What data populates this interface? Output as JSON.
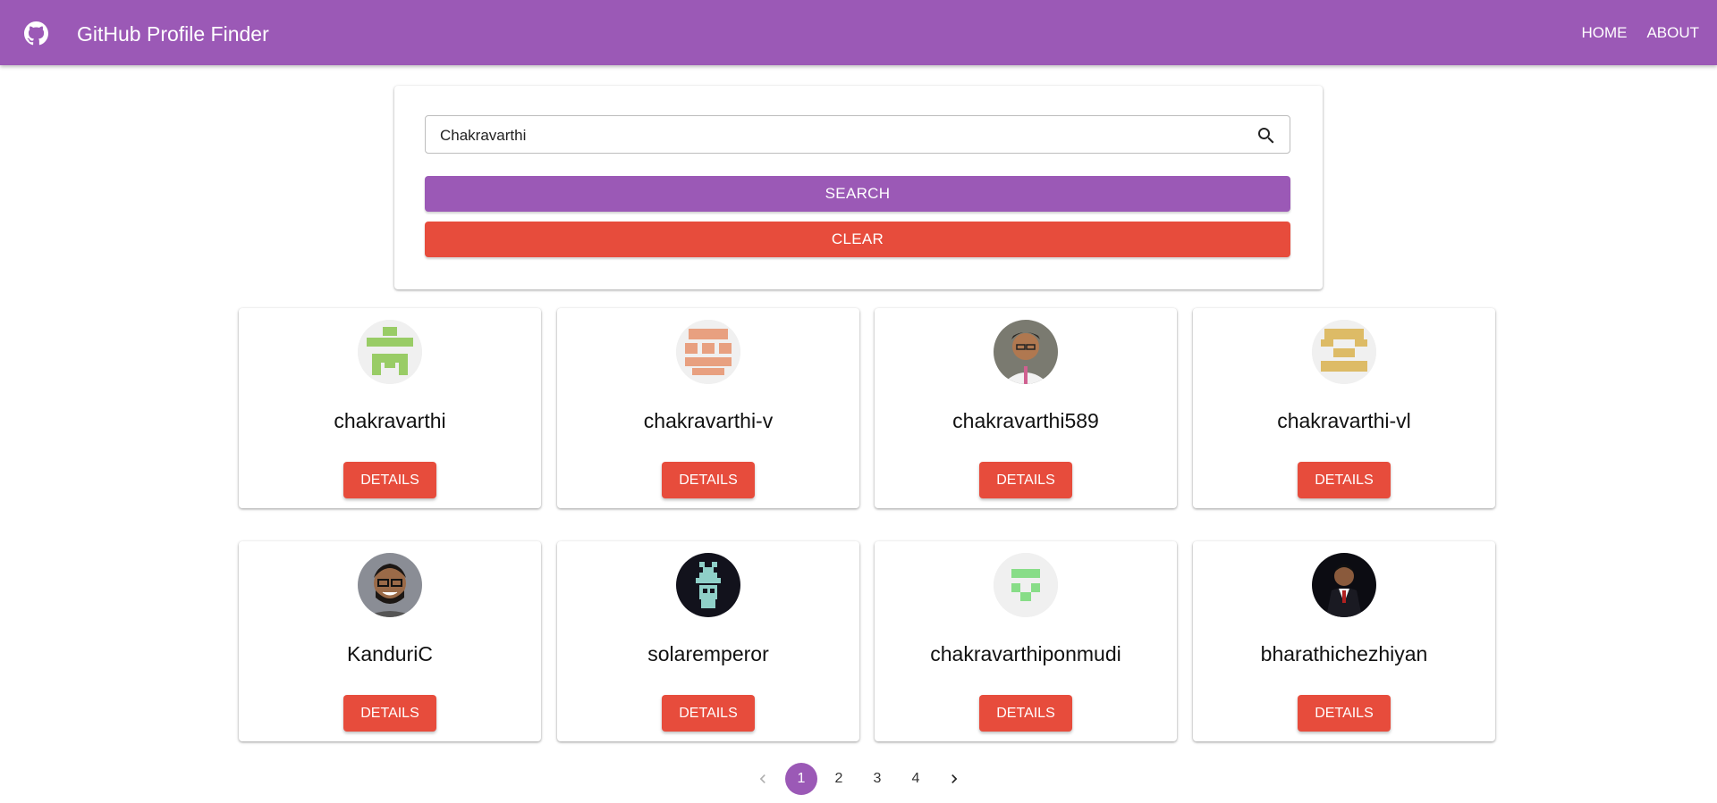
{
  "app": {
    "title": "GitHub Profile Finder",
    "brand_color": "#9b59b6",
    "danger_color": "#e74c3c",
    "logo_icon": "github-icon"
  },
  "nav": {
    "items": [
      "HOME",
      "ABOUT"
    ]
  },
  "search": {
    "value": "Chakravarthi",
    "icon": "search-icon",
    "search_label": "SEARCH",
    "clear_label": "CLEAR"
  },
  "users": [
    {
      "username": "chakravarthi",
      "avatar": "identicon-green",
      "details_label": "DETAILS"
    },
    {
      "username": "chakravarthi-v",
      "avatar": "identicon-salmon",
      "details_label": "DETAILS"
    },
    {
      "username": "chakravarthi589",
      "avatar": "photo",
      "details_label": "DETAILS"
    },
    {
      "username": "chakravarthi-vl",
      "avatar": "identicon-gold",
      "details_label": "DETAILS"
    },
    {
      "username": "KanduriC",
      "avatar": "photo",
      "details_label": "DETAILS"
    },
    {
      "username": "solaremperor",
      "avatar": "pixel-robot",
      "details_label": "DETAILS"
    },
    {
      "username": "chakravarthiponmudi",
      "avatar": "identicon-green",
      "details_label": "DETAILS"
    },
    {
      "username": "bharathichezhiyan",
      "avatar": "photo",
      "details_label": "DETAILS"
    }
  ],
  "pagination": {
    "pages": [
      "1",
      "2",
      "3",
      "4"
    ],
    "current": "1",
    "prev_icon": "chevron-left-icon",
    "next_icon": "chevron-right-icon"
  }
}
